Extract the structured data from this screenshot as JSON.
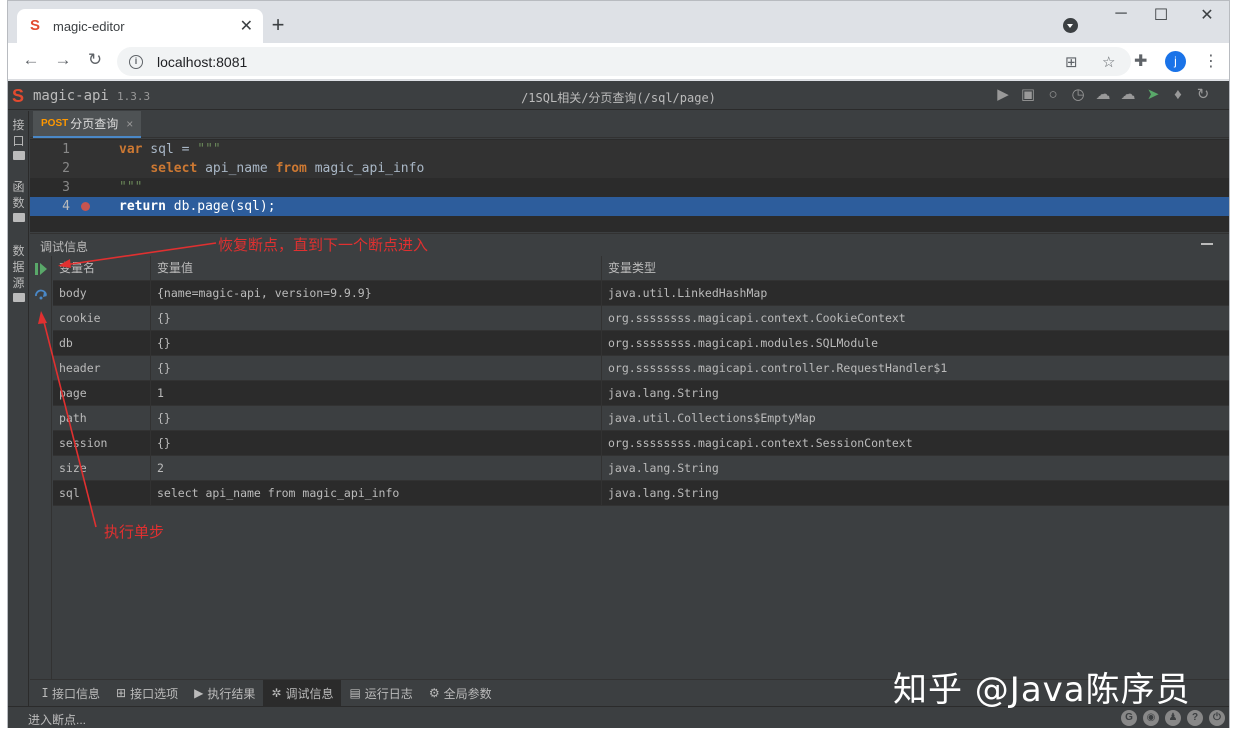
{
  "browser": {
    "tab_title": "magic-editor",
    "tab_logo": "S",
    "url": "localhost:8081",
    "avatar_letter": "j",
    "new_tab": "+",
    "minimize": "─",
    "maximize": "☐",
    "close": "✕"
  },
  "app": {
    "logo": "S",
    "name": "magic-api",
    "version": "1.3.3",
    "path": "/1SQL相关/分页查询(/sql/page)",
    "header_icons": [
      "play-icon",
      "save-icon",
      "search-icon",
      "history-icon",
      "upload-icon",
      "download-icon",
      "send-icon",
      "skin-icon",
      "refresh-icon"
    ]
  },
  "sidebar": {
    "groups": [
      {
        "label": "接口",
        "chars": [
          "接",
          "口"
        ]
      },
      {
        "label": "函数",
        "chars": [
          "函",
          "数"
        ]
      },
      {
        "label": "数据源",
        "chars": [
          "数",
          "据",
          "源"
        ]
      }
    ]
  },
  "editor_tab": {
    "method": "POST",
    "title": "分页查询",
    "close": "×"
  },
  "code_lines": [
    {
      "num": "1"
    },
    {
      "num": "2"
    },
    {
      "num": "3"
    },
    {
      "num": "4"
    }
  ],
  "code": {
    "l1_kw": "var",
    "l1_rest": " sql = ",
    "l1_str": "\"\"\"",
    "l2_indent": "    ",
    "l2_kw1": "select",
    "l2_mid": " api_name ",
    "l2_kw2": "from",
    "l2_rest": " magic_api_info",
    "l3_str": "\"\"\"",
    "l4_kw": "return",
    "l4_rest": " db.page(sql);"
  },
  "debug": {
    "title": "调试信息",
    "columns": [
      "变量名",
      "变量值",
      "变量类型"
    ],
    "rows": [
      {
        "name": "body",
        "value": "{name=magic-api, version=9.9.9}",
        "type": "java.util.LinkedHashMap"
      },
      {
        "name": "cookie",
        "value": "{}",
        "type": "org.ssssssss.magicapi.context.CookieContext"
      },
      {
        "name": "db",
        "value": "{}",
        "type": "org.ssssssss.magicapi.modules.SQLModule"
      },
      {
        "name": "header",
        "value": "{}",
        "type": "org.ssssssss.magicapi.controller.RequestHandler$1"
      },
      {
        "name": "page",
        "value": "1",
        "type": "java.lang.String"
      },
      {
        "name": "path",
        "value": "{}",
        "type": "java.util.Collections$EmptyMap"
      },
      {
        "name": "session",
        "value": "{}",
        "type": "org.ssssssss.magicapi.context.SessionContext"
      },
      {
        "name": "size",
        "value": "2",
        "type": "java.lang.String"
      },
      {
        "name": "sql",
        "value": "select api_name from magic_api_info",
        "type": "java.lang.String"
      }
    ]
  },
  "bottom_tabs": [
    {
      "label": "接口信息",
      "icon": "info-icon"
    },
    {
      "label": "接口选项",
      "icon": "grid-icon"
    },
    {
      "label": "执行结果",
      "icon": "play-icon"
    },
    {
      "label": "调试信息",
      "icon": "bug-icon",
      "active": true
    },
    {
      "label": "运行日志",
      "icon": "log-icon"
    },
    {
      "label": "全局参数",
      "icon": "gear-icon"
    }
  ],
  "status": {
    "text": "进入断点..."
  },
  "annotations": {
    "resume": "恢复断点，直到下一个断点进入",
    "step": "执行单步",
    "watermark": "知乎 @Java陈序员"
  },
  "colors": {
    "accent": "#4a88c7",
    "breakpoint": "#c75450",
    "highlight_line": "#2d5d9c",
    "annotation": "#e03030",
    "resume_green": "#59a869"
  }
}
